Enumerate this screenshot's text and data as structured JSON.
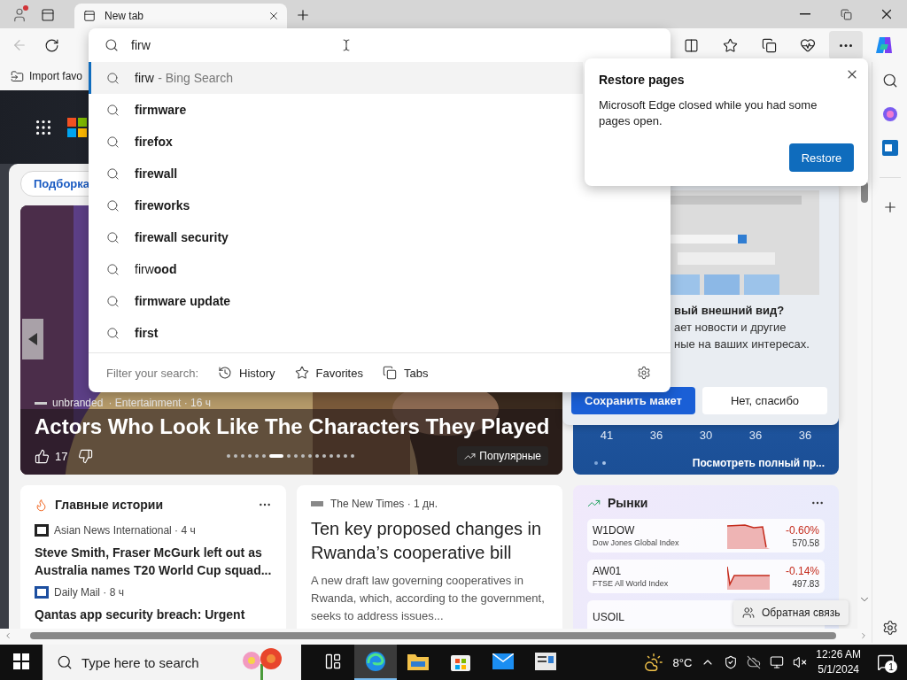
{
  "browser": {
    "tab": {
      "title": "New tab",
      "selected": true
    },
    "back": {
      "disabled": true
    },
    "address": {
      "value": "firw"
    },
    "favorites_bar": {
      "import_link": "Import favo"
    }
  },
  "omnibox": {
    "suggestions": [
      {
        "kind": "web",
        "query": "firw",
        "suffix": "- Bing Search",
        "selected": true
      },
      {
        "kind": "suggestion",
        "text": "firmware",
        "bold": true,
        "selected": false
      },
      {
        "kind": "suggestion",
        "text": "firefox",
        "bold": true,
        "selected": false
      },
      {
        "kind": "suggestion",
        "text": "firewall",
        "bold": true,
        "selected": false
      },
      {
        "kind": "suggestion",
        "text": "fireworks",
        "bold": true,
        "selected": false
      },
      {
        "kind": "suggestion",
        "text": "firewall security",
        "bold": true,
        "selected": false
      },
      {
        "kind": "suggestion",
        "text": "firw**ood**",
        "bold": false,
        "selected": false
      },
      {
        "kind": "suggestion",
        "text": "firmware update",
        "bold": true,
        "selected": false
      },
      {
        "kind": "suggestion",
        "text": "first",
        "bold": true,
        "selected": false
      }
    ],
    "filter_label": "Filter your search:",
    "filters": [
      {
        "kind": "history",
        "label": "History"
      },
      {
        "kind": "favorites",
        "label": "Favorites"
      },
      {
        "kind": "tabs",
        "label": "Tabs"
      }
    ]
  },
  "restore_popup": {
    "title": "Restore pages",
    "message": "Microsoft Edge closed while you had some pages open.",
    "button": "Restore"
  },
  "feed": {
    "pill": "Подборка",
    "hero": {
      "source": "unbranded",
      "byline": "· Entertainment · 16 ч",
      "title": "Actors Who Look Like The Characters They Played",
      "likes": "17",
      "chip": "Популярные",
      "slides": [
        {
          "selected": false
        },
        {
          "selected": false
        },
        {
          "selected": false
        },
        {
          "selected": false
        },
        {
          "selected": false
        },
        {
          "selected": false
        },
        {
          "selected": true
        },
        {
          "selected": false
        },
        {
          "selected": false
        },
        {
          "selected": false
        },
        {
          "selected": false
        },
        {
          "selected": false
        },
        {
          "selected": false
        },
        {
          "selected": false
        },
        {
          "selected": false
        },
        {
          "selected": false
        },
        {
          "selected": false
        }
      ]
    },
    "layout_prompt": {
      "title": "вый внешний вид?",
      "lines": [
        "ает новости и другие",
        "ные на ваших интересах."
      ],
      "primary": "Сохранить макет",
      "secondary": "Нет, спасибо"
    },
    "weather": {
      "values": [
        "41",
        "36",
        "30",
        "36",
        "36"
      ],
      "link": "Посмотреть полный пр..."
    },
    "top_stories": {
      "title": "Главные истории",
      "items": [
        {
          "source": "Asian News International · 4 ч",
          "headline": "Steve Smith, Fraser McGurk left out as Australia names T20 World Cup squad..."
        },
        {
          "source": "Daily Mail · 8 ч",
          "headline": "Qantas app security breach: Urgent"
        }
      ]
    },
    "article": {
      "source": "The New Times · 1 дн.",
      "title": "Ten key proposed changes in Rwanda’s cooperative bill",
      "summary": "A new draft law governing cooperatives in Rwanda, which, according to the government, seeks to address issues..."
    },
    "markets": {
      "title": "Рынки",
      "rows": [
        {
          "symbol": "W1DOW",
          "name": "Dow Jones Global Index",
          "change": "-0.60%",
          "price": "570.58"
        },
        {
          "symbol": "AW01",
          "name": "FTSE All World Index",
          "change": "-0.14%",
          "price": "497.83"
        },
        {
          "symbol": "USOIL"
        }
      ]
    },
    "feedback": "Обратная связь"
  },
  "taskbar": {
    "search_placeholder": "Type here to search",
    "apps": [
      {
        "kind": "taskview",
        "selected": false
      },
      {
        "kind": "edge",
        "selected": true
      },
      {
        "kind": "explorer",
        "selected": false
      },
      {
        "kind": "store",
        "selected": false
      },
      {
        "kind": "mail",
        "selected": false
      },
      {
        "kind": "news",
        "selected": false
      }
    ],
    "temperature": "8°C",
    "time": "12:26 AM",
    "date": "5/1/2024",
    "notifications": "1"
  }
}
